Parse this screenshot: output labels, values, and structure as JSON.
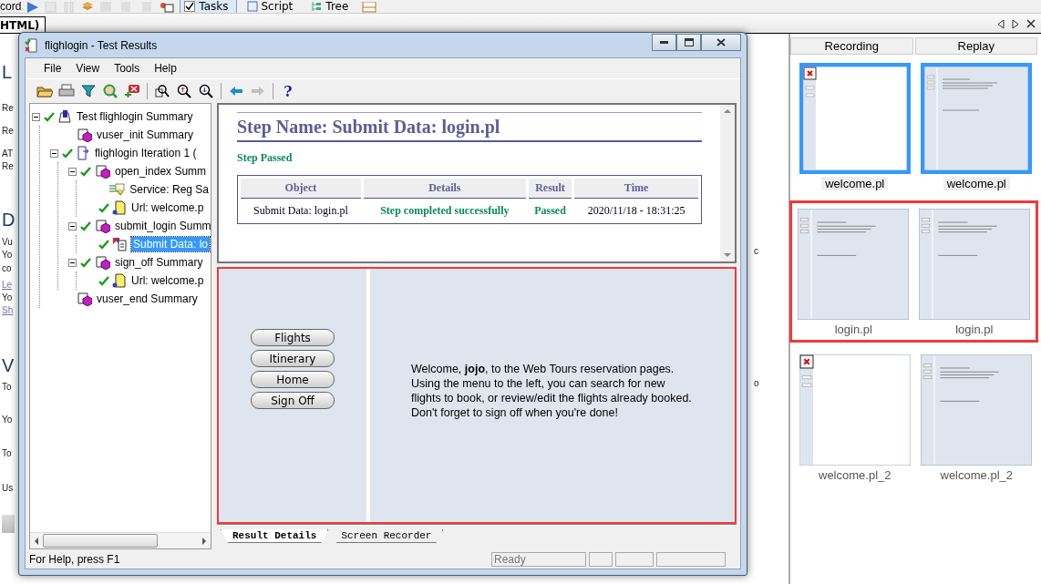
{
  "background_app": {
    "toolbar": [
      {
        "kind": "text",
        "label": "cord"
      },
      {
        "kind": "icon",
        "disabled": false
      },
      {
        "kind": "icon",
        "disabled": true
      },
      {
        "kind": "icon",
        "disabled": true
      },
      {
        "kind": "icon",
        "disabled": false
      },
      {
        "kind": "icon",
        "disabled": true
      },
      {
        "kind": "icon",
        "disabled": true
      },
      {
        "kind": "icon",
        "disabled": true
      },
      {
        "kind": "icon",
        "disabled": false
      },
      {
        "kind": "tab",
        "label": "Tasks",
        "selected": true
      },
      {
        "kind": "tab",
        "label": "Script",
        "selected": false
      },
      {
        "kind": "tab",
        "label": "Tree",
        "selected": false
      },
      {
        "kind": "icon",
        "disabled": false
      }
    ],
    "document_tab": "HTML)",
    "document_fragments": [
      {
        "kind": "heading",
        "text": "L"
      },
      {
        "kind": "text",
        "text": "Re"
      },
      {
        "kind": "text",
        "text": "Re"
      },
      {
        "kind": "text",
        "text": "AT"
      },
      {
        "kind": "text",
        "text": "Re"
      },
      {
        "kind": "heading",
        "text": "D"
      },
      {
        "kind": "text",
        "text": "Vu"
      },
      {
        "kind": "text",
        "text": "Yo"
      },
      {
        "kind": "text",
        "text": "co"
      },
      {
        "kind": "link",
        "text": "Le"
      },
      {
        "kind": "text",
        "text": "Yo"
      },
      {
        "kind": "link",
        "text": "Sh"
      },
      {
        "kind": "heading",
        "text": "V"
      },
      {
        "kind": "text",
        "text": "To"
      },
      {
        "kind": "text",
        "text": "Yo"
      },
      {
        "kind": "text",
        "text": "To"
      },
      {
        "kind": "text",
        "text": "Us"
      },
      {
        "kind": "button"
      }
    ],
    "document_fragments_right": [
      "c",
      "o"
    ],
    "thumbnails": {
      "columns": [
        "Recording",
        "Replay"
      ],
      "rows": [
        {
          "highlighted": false,
          "items": [
            {
              "label": "welcome.pl",
              "kind": "blank",
              "selected": true
            },
            {
              "label": "welcome.pl",
              "kind": "page",
              "selected": true
            }
          ]
        },
        {
          "highlighted": true,
          "items": [
            {
              "label": "login.pl",
              "kind": "page",
              "selected": false
            },
            {
              "label": "login.pl",
              "kind": "page",
              "selected": false
            }
          ]
        },
        {
          "highlighted": false,
          "items": [
            {
              "label": "welcome.pl_2",
              "kind": "blank",
              "selected": false
            },
            {
              "label": "welcome.pl_2",
              "kind": "page",
              "selected": false
            }
          ]
        }
      ]
    }
  },
  "window": {
    "title": "flighlogin - Test Results",
    "menu": [
      "File",
      "View",
      "Tools",
      "Help"
    ],
    "toolbar": [
      [
        {
          "disabled": false
        },
        {
          "disabled": false
        },
        {
          "disabled": false
        },
        {
          "disabled": false
        },
        {
          "disabled": false
        }
      ],
      [
        {
          "disabled": false
        },
        {
          "disabled": false
        },
        {
          "disabled": false
        }
      ],
      [
        {
          "disabled": false
        },
        {
          "disabled": true
        }
      ],
      [
        {
          "label": "?",
          "disabled": false
        }
      ]
    ],
    "tree": [
      {
        "label": "Test flighlogin Summary",
        "kind": "test",
        "passed": true,
        "expanded": true,
        "selected": false,
        "children": [
          {
            "label": "vuser_init Summary",
            "kind": "action",
            "passed": false,
            "selected": false
          },
          {
            "label": "flighlogin Iteration 1 (",
            "kind": "iteration",
            "passed": true,
            "expanded": true,
            "selected": false,
            "children": [
              {
                "label": "open_index Summ",
                "kind": "action",
                "passed": true,
                "expanded": true,
                "selected": false,
                "children": [
                  {
                    "label": "Service: Reg Sa",
                    "kind": "service",
                    "passed": false,
                    "selected": false
                  },
                  {
                    "label": "Url: welcome.p",
                    "kind": "url",
                    "passed": true,
                    "selected": false
                  }
                ]
              },
              {
                "label": "submit_login Summ",
                "kind": "action",
                "passed": true,
                "expanded": true,
                "selected": false,
                "children": [
                  {
                    "label": "Submit Data: lo",
                    "kind": "submit",
                    "passed": true,
                    "selected": true
                  }
                ]
              },
              {
                "label": "sign_off Summary",
                "kind": "action",
                "passed": true,
                "expanded": true,
                "selected": false,
                "children": [
                  {
                    "label": "Url: welcome.p",
                    "kind": "url",
                    "passed": true,
                    "selected": false
                  }
                ]
              }
            ]
          },
          {
            "label": "vuser_end Summary",
            "kind": "action",
            "passed": false,
            "selected": false
          }
        ]
      }
    ],
    "step": {
      "title": "Step Name: Submit Data: login.pl",
      "status": "Step Passed",
      "table": {
        "columns": [
          "Object",
          "Details",
          "Result",
          "Time"
        ],
        "rows": [
          [
            "Submit Data: login.pl",
            "Step completed successfully",
            "Passed",
            "2020/11/18 - 18:31:25"
          ]
        ]
      }
    },
    "browser": {
      "highlighted": true,
      "nav_buttons": [
        "Flights",
        "Itinerary",
        "Home",
        "Sign Off"
      ],
      "message": "Welcome, **jojo**, to the Web Tours reservation pages. Using the menu to the left, you can search for new flights to book, or review/edit the flights already booked. Don't forget to sign off when you're done!"
    },
    "tabs": [
      {
        "label": "Result Details",
        "selected": true
      },
      {
        "label": "Screen Recorder",
        "selected": false
      }
    ],
    "status_bar": {
      "help": "For Help, press F1",
      "panes": [
        "Ready"
      ]
    }
  }
}
